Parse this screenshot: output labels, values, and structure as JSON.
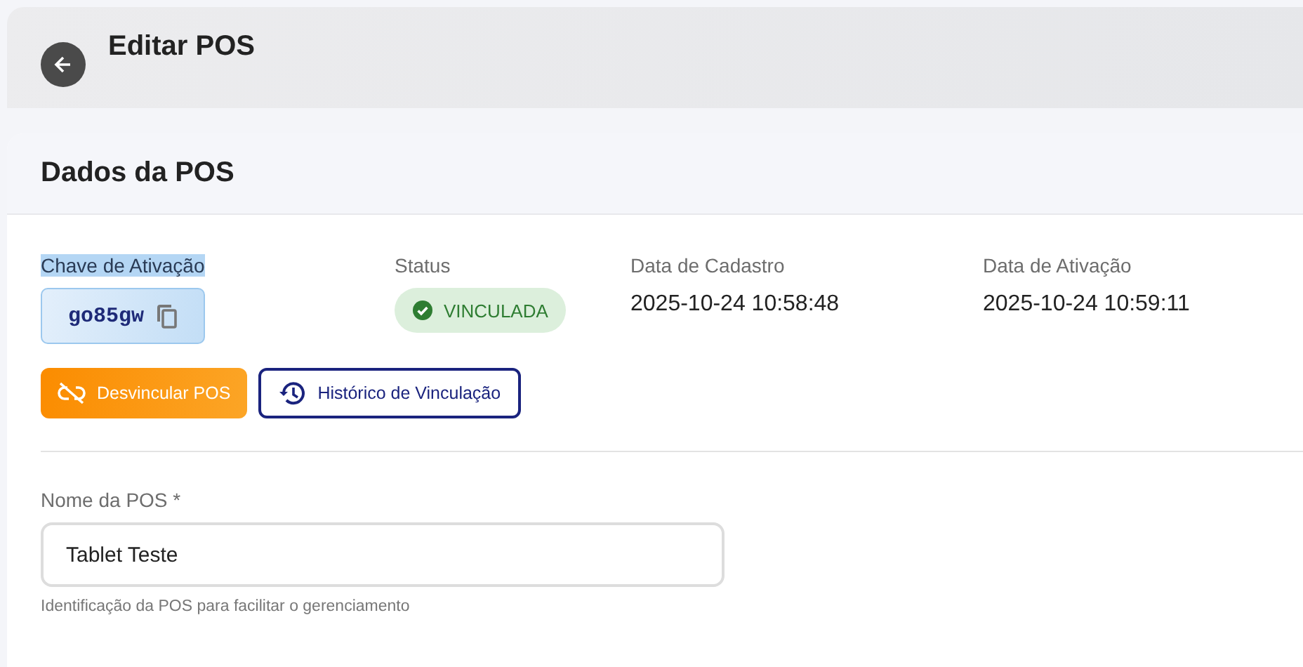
{
  "header": {
    "title": "Editar POS"
  },
  "card": {
    "title": "Dados da POS"
  },
  "activation_key": {
    "label": "Chave de Ativação",
    "highlighted": true,
    "value": "go85gw"
  },
  "status": {
    "label": "Status",
    "value": "VINCULADA",
    "kind": "success"
  },
  "dates": [
    {
      "label": "Data de Cadastro",
      "value": "2025-10-24 10:58:48"
    },
    {
      "label": "Data de Ativação",
      "value": "2025-10-24 10:59:11"
    }
  ],
  "actions": [
    {
      "label": "Desvincular POS",
      "kind": "primary"
    },
    {
      "label": "Histórico de Vinculação",
      "kind": "outline"
    }
  ],
  "name_field": {
    "label": "Nome da POS *",
    "value": "Tablet Teste",
    "helper": "Identificação da POS para facilitar o gerenciamento"
  }
}
